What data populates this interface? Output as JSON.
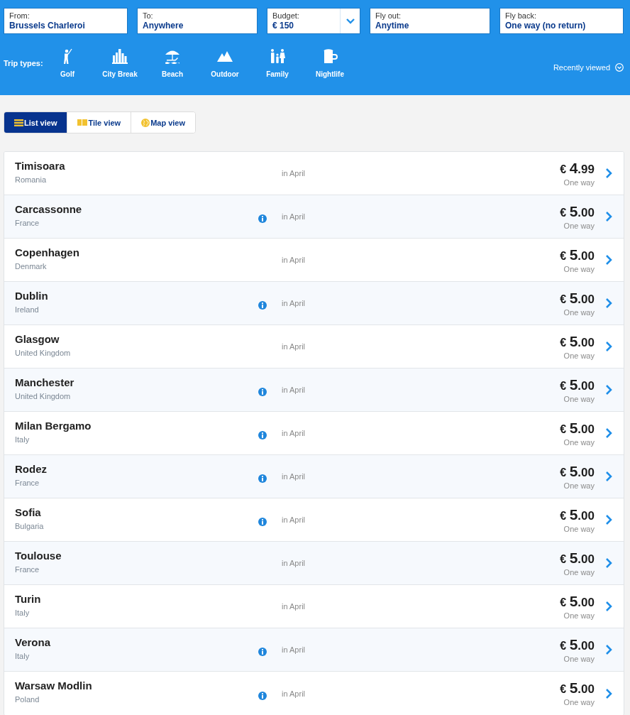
{
  "search_fields": [
    {
      "label": "From:",
      "value": "Brussels Charleroi",
      "dropdown": false
    },
    {
      "label": "To:",
      "value": "Anywhere",
      "dropdown": false
    },
    {
      "label": "Budget:",
      "value": "€ 150",
      "dropdown": true
    },
    {
      "label": "Fly out:",
      "value": "Anytime",
      "dropdown": false
    },
    {
      "label": "Fly back:",
      "value": "One way (no return)",
      "dropdown": false
    }
  ],
  "trip_types": {
    "label": "Trip types:",
    "items": [
      {
        "kind": "golf",
        "label": "Golf"
      },
      {
        "kind": "city",
        "label": "City Break"
      },
      {
        "kind": "beach",
        "label": "Beach"
      },
      {
        "kind": "outdoor",
        "label": "Outdoor"
      },
      {
        "kind": "family",
        "label": "Family"
      },
      {
        "kind": "nightlife",
        "label": "Nightlife"
      }
    ]
  },
  "recently_viewed": {
    "label": "Recently viewed",
    "expanded": false
  },
  "view_tabs": [
    {
      "kind": "list",
      "label": "List view",
      "selected": true
    },
    {
      "kind": "tile",
      "label": "Tile view",
      "selected": false
    },
    {
      "kind": "map",
      "label": "Map view",
      "selected": false
    }
  ],
  "destinations": [
    {
      "city": "Timisoara",
      "country": "Romania",
      "info": false,
      "when": "in April",
      "price": {
        "currency": "€",
        "whole": "4",
        "fraction": ".99"
      },
      "fare_type": "One way"
    },
    {
      "city": "Carcassonne",
      "country": "France",
      "info": true,
      "when": "in April",
      "price": {
        "currency": "€",
        "whole": "5",
        "fraction": ".00"
      },
      "fare_type": "One way"
    },
    {
      "city": "Copenhagen",
      "country": "Denmark",
      "info": false,
      "when": "in April",
      "price": {
        "currency": "€",
        "whole": "5",
        "fraction": ".00"
      },
      "fare_type": "One way"
    },
    {
      "city": "Dublin",
      "country": "Ireland",
      "info": true,
      "when": "in April",
      "price": {
        "currency": "€",
        "whole": "5",
        "fraction": ".00"
      },
      "fare_type": "One way"
    },
    {
      "city": "Glasgow",
      "country": "United Kingdom",
      "info": false,
      "when": "in April",
      "price": {
        "currency": "€",
        "whole": "5",
        "fraction": ".00"
      },
      "fare_type": "One way"
    },
    {
      "city": "Manchester",
      "country": "United Kingdom",
      "info": true,
      "when": "in April",
      "price": {
        "currency": "€",
        "whole": "5",
        "fraction": ".00"
      },
      "fare_type": "One way"
    },
    {
      "city": "Milan Bergamo",
      "country": "Italy",
      "info": true,
      "when": "in April",
      "price": {
        "currency": "€",
        "whole": "5",
        "fraction": ".00"
      },
      "fare_type": "One way"
    },
    {
      "city": "Rodez",
      "country": "France",
      "info": true,
      "when": "in April",
      "price": {
        "currency": "€",
        "whole": "5",
        "fraction": ".00"
      },
      "fare_type": "One way"
    },
    {
      "city": "Sofia",
      "country": "Bulgaria",
      "info": true,
      "when": "in April",
      "price": {
        "currency": "€",
        "whole": "5",
        "fraction": ".00"
      },
      "fare_type": "One way"
    },
    {
      "city": "Toulouse",
      "country": "France",
      "info": false,
      "when": "in April",
      "price": {
        "currency": "€",
        "whole": "5",
        "fraction": ".00"
      },
      "fare_type": "One way"
    },
    {
      "city": "Turin",
      "country": "Italy",
      "info": false,
      "when": "in April",
      "price": {
        "currency": "€",
        "whole": "5",
        "fraction": ".00"
      },
      "fare_type": "One way"
    },
    {
      "city": "Verona",
      "country": "Italy",
      "info": true,
      "when": "in April",
      "price": {
        "currency": "€",
        "whole": "5",
        "fraction": ".00"
      },
      "fare_type": "One way"
    },
    {
      "city": "Warsaw Modlin",
      "country": "Poland",
      "info": true,
      "when": "in April",
      "price": {
        "currency": "€",
        "whole": "5",
        "fraction": ".00"
      },
      "fare_type": "One way"
    }
  ]
}
